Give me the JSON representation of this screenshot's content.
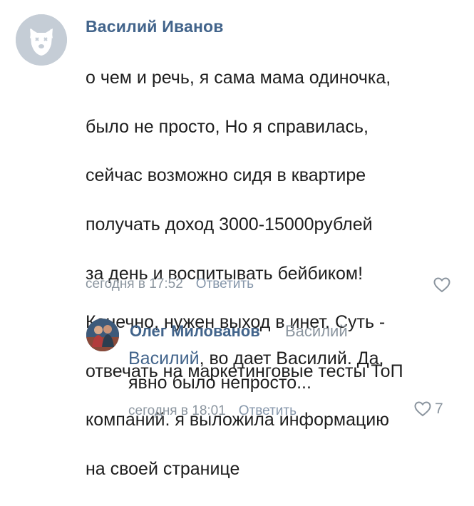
{
  "comment": {
    "author": "Василий Иванов",
    "lines": [
      "о чем и речь, я сама мама одиночка,",
      "было не просто, Но я справилась,",
      "сейчас возможно сидя в квартире",
      "получать доход 3000-15000рублей",
      "за день и воспитывать бейбиком!",
      "Конечно, нужен выход в инет. Суть -",
      "отвечать на маркетинговые тесты ТоП",
      "компаний. я выложила информацию",
      "на своей странице"
    ],
    "time": "сегодня в 17:52",
    "reply_label": "Ответить",
    "icons": {
      "avatar": "avatar-deactivated-dog-icon",
      "like": "heart-icon"
    }
  },
  "reply": {
    "author": "Олег Милованов",
    "addressee": "Василий",
    "mention": "Василий",
    "text_after_mention": ", во дает Василий. Да,",
    "text_line2": "явно было непросто...",
    "time": "сегодня в 18:01",
    "reply_label": "Ответить",
    "like_count": "7",
    "icons": {
      "avatar": "avatar-photo-icon",
      "like": "heart-icon"
    }
  },
  "colors": {
    "author": "#42648b",
    "meta": "#8a949e",
    "text": "#1e1e1e",
    "background": "#ffffff"
  }
}
